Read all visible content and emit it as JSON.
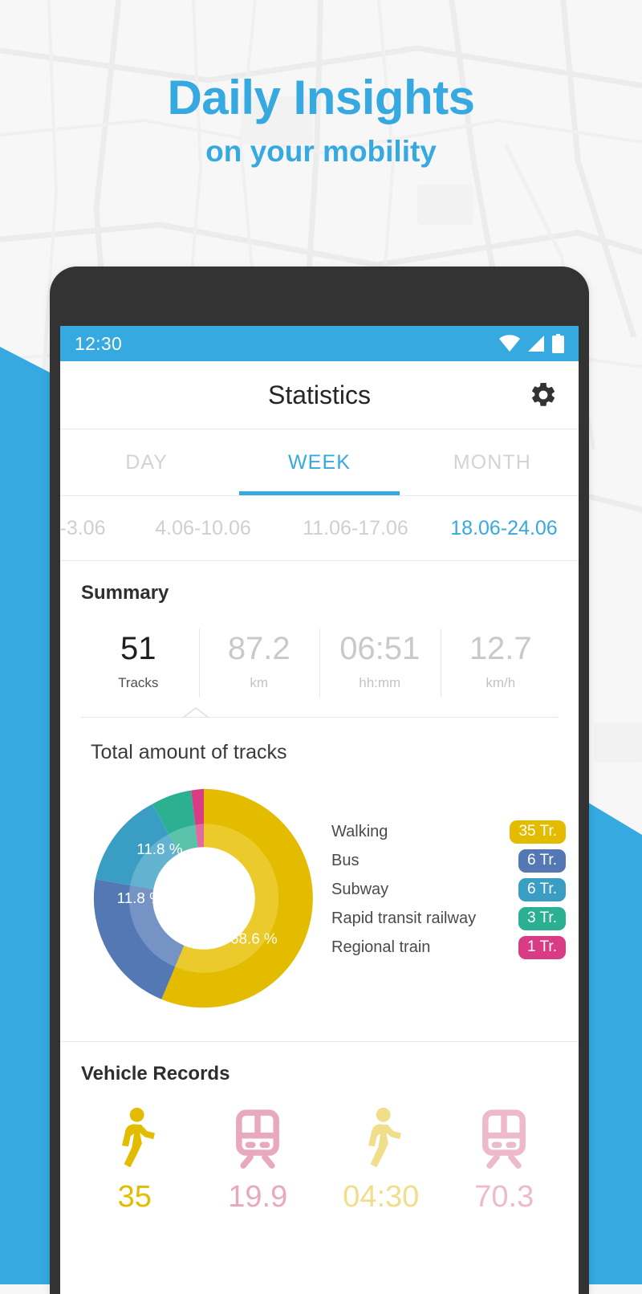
{
  "headline": {
    "line1": "Daily Insights",
    "line2": "on your mobility"
  },
  "colors": {
    "brand_blue": "#35a9e0",
    "walking_yellow": "#e3bc00",
    "bus_indigo": "#5478b4",
    "subway_blue": "#3a9dc4",
    "rapid_green": "#2bb191",
    "regional_pink": "#d93c85",
    "train_pink": "#e8a9bf",
    "phone_frame": "#333333"
  },
  "statusbar": {
    "time": "12:30",
    "icons": [
      "wifi-icon",
      "signal-icon",
      "battery-icon"
    ]
  },
  "appbar": {
    "title": "Statistics",
    "settings_icon": "gear-icon"
  },
  "tabs": [
    {
      "label": "DAY",
      "active": false
    },
    {
      "label": "WEEK",
      "active": true
    },
    {
      "label": "MONTH",
      "active": false
    }
  ],
  "weeks": [
    {
      "label": "-3.06",
      "active": false
    },
    {
      "label": "4.06-10.06",
      "active": false
    },
    {
      "label": "11.06-17.06",
      "active": false
    },
    {
      "label": "18.06-24.06",
      "active": true
    }
  ],
  "summary": {
    "title": "Summary",
    "stats": [
      {
        "value": "51",
        "unit": "Tracks",
        "primary": true
      },
      {
        "value": "87.2",
        "unit": "km",
        "primary": false
      },
      {
        "value": "06:51",
        "unit": "hh:mm",
        "primary": false
      },
      {
        "value": "12.7",
        "unit": "km/h",
        "primary": false
      }
    ],
    "collapse_icon": "chevron-up-icon"
  },
  "chart_data": {
    "type": "pie",
    "title": "Total amount of tracks",
    "categories": [
      "Walking",
      "Bus",
      "Subway",
      "Rapid transit railway",
      "Regional train"
    ],
    "values": [
      35,
      6,
      6,
      3,
      1
    ],
    "percents": [
      68.6,
      11.8,
      11.8,
      5.9,
      2.0
    ],
    "visible_labels": [
      "68.6 %",
      "11.8 %",
      "11.8 %"
    ],
    "colors": [
      "#e3bc00",
      "#5478b4",
      "#3a9dc4",
      "#2bb191",
      "#d93c85"
    ],
    "badges": [
      "35 Tr.",
      "6 Tr.",
      "6 Tr.",
      "3 Tr.",
      "1 Tr."
    ],
    "legend_position": "right",
    "total": 51,
    "unit": "Tr.",
    "xlabel": "",
    "ylabel": ""
  },
  "records": {
    "title": "Vehicle Records",
    "items": [
      {
        "icon": "walking-icon",
        "value": "35",
        "color": "#e3bc00"
      },
      {
        "icon": "train-icon",
        "value": "19.9",
        "color": "#e8a9bf"
      },
      {
        "icon": "walking-icon",
        "value": "04:30",
        "color": "#f0de8a"
      },
      {
        "icon": "train-icon",
        "value": "70.3",
        "color": "#eeb9cb"
      }
    ]
  }
}
